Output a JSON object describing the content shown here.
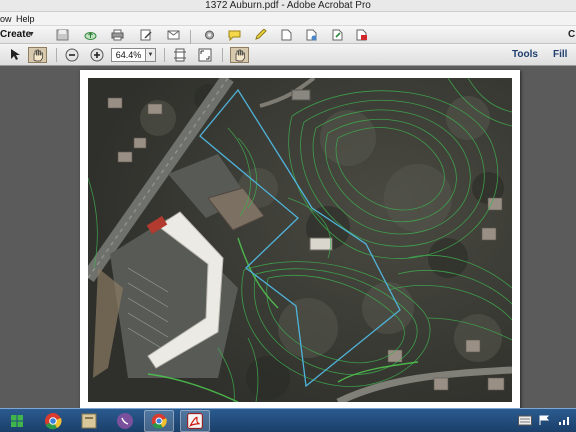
{
  "window": {
    "title": "1372 Auburn.pdf - Adobe Acrobat Pro"
  },
  "menu": {
    "items": [
      "ow",
      "Help"
    ]
  },
  "toolbar1": {
    "create_label": "Create",
    "right_label": "C"
  },
  "toolbar2": {
    "zoom_value": "64.4%",
    "tools_label": "Tools",
    "fill_sign_label": "Fill &"
  },
  "icons": {
    "toolbar1": [
      "save-icon",
      "cloud-upload-icon",
      "print-icon",
      "edit-icon",
      "email-icon",
      "settings-icon",
      "comment-icon",
      "highlight-icon",
      "document-icon",
      "attach-icon",
      "export-icon",
      "pdf-icon"
    ],
    "toolbar2": [
      "select-arrow-icon",
      "hand-tool-icon",
      "zoom-out-icon",
      "zoom-in-icon",
      "fit-page-icon",
      "full-screen-icon",
      "hand-tool-icon"
    ],
    "taskbar": [
      "windows-start-icon",
      "chrome-icon",
      "file-manager-icon",
      "viber-icon",
      "chrome-icon",
      "acrobat-icon"
    ]
  },
  "colors": {
    "parcel_outline": "#4fb3d9",
    "contour_lines": "#3fae4f",
    "taskbar": "#1e4a7a"
  }
}
